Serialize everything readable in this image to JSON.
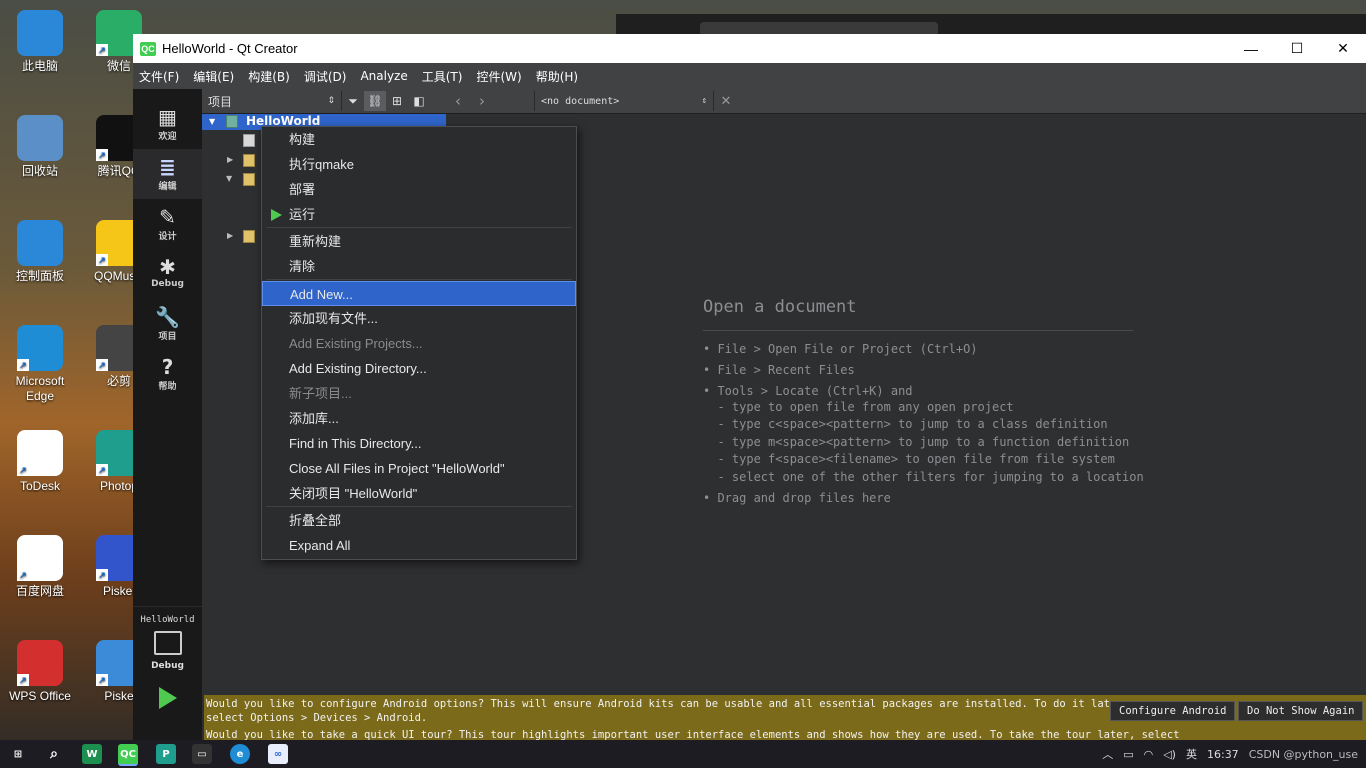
{
  "desktop": {
    "icons": [
      {
        "label": "此电脑",
        "icon": "computer-icon",
        "color": "#2b88d8"
      },
      {
        "label": "微信",
        "icon": "wechat-icon",
        "color": "#2aae67"
      },
      {
        "label": "回收站",
        "icon": "recycle-bin-icon",
        "color": "#5a8fc8"
      },
      {
        "label": "腾讯QQ",
        "icon": "qq-icon",
        "color": "#111111"
      },
      {
        "label": "控制面板",
        "icon": "control-panel-icon",
        "color": "#2b88d8"
      },
      {
        "label": "QQMusic",
        "icon": "qqmusic-icon",
        "color": "#f5c518"
      },
      {
        "label": "Microsoft Edge",
        "icon": "edge-icon",
        "color": "#1f8dd6"
      },
      {
        "label": "必剪",
        "icon": "bijian-icon",
        "color": "#444444"
      },
      {
        "label": "ToDesk",
        "icon": "todesk-icon",
        "color": "#ffffff"
      },
      {
        "label": "Photop",
        "icon": "photopea-icon",
        "color": "#1f9e8e"
      },
      {
        "label": "百度网盘",
        "icon": "baidu-netdisk-icon",
        "color": "#ffffff"
      },
      {
        "label": "Piskel",
        "icon": "piskel-icon",
        "color": "#3355cc"
      },
      {
        "label": "WPS Office",
        "icon": "wps-icon",
        "color": "#d32f2f"
      },
      {
        "label": "Piske",
        "icon": "piske-icon",
        "color": "#3b8bd8"
      }
    ]
  },
  "window": {
    "title": "HelloWorld - Qt Creator",
    "app_icon_text": "QC",
    "controls": {
      "minimize": "—",
      "maximize": "☐",
      "close": "✕"
    }
  },
  "menubar": [
    "文件(F)",
    "编辑(E)",
    "构建(B)",
    "调试(D)",
    "Analyze",
    "工具(T)",
    "控件(W)",
    "帮助(H)"
  ],
  "modes": [
    {
      "label": "欢迎",
      "icon": "grid-icon",
      "glyph": "▦"
    },
    {
      "label": "编辑",
      "icon": "edit-doc-icon",
      "glyph": "≣"
    },
    {
      "label": "设计",
      "icon": "pencil-icon",
      "glyph": "✎"
    },
    {
      "label": "Debug",
      "icon": "bug-icon",
      "glyph": "✱"
    },
    {
      "label": "项目",
      "icon": "wrench-icon",
      "glyph": "🔧"
    },
    {
      "label": "帮助",
      "icon": "help-icon",
      "glyph": "?"
    }
  ],
  "navigator": {
    "combo": "项目",
    "root": "HelloWorld"
  },
  "editor_toolbar": {
    "document": "<no document>"
  },
  "context_menu": {
    "items": [
      {
        "label": "构建",
        "enabled": true
      },
      {
        "label": "执行qmake",
        "enabled": true
      },
      {
        "label": "部署",
        "enabled": true
      },
      {
        "label": "运行",
        "enabled": true
      },
      {
        "label": "重新构建",
        "enabled": true
      },
      {
        "label": "清除",
        "enabled": true
      },
      {
        "label": "Add New...",
        "enabled": true,
        "highlighted": true
      },
      {
        "label": "添加现有文件...",
        "enabled": true
      },
      {
        "label": "Add Existing Projects...",
        "enabled": false
      },
      {
        "label": "Add Existing Directory...",
        "enabled": true
      },
      {
        "label": "新子项目...",
        "enabled": false
      },
      {
        "label": "添加库...",
        "enabled": true
      },
      {
        "label": "Find in This Directory...",
        "enabled": true
      },
      {
        "label": "Close All Files in Project \"HelloWorld\"",
        "enabled": true
      },
      {
        "label": "关闭项目 \"HelloWorld\"",
        "enabled": true
      },
      {
        "label": "折叠全部",
        "enabled": true
      },
      {
        "label": "Expand All",
        "enabled": true
      }
    ]
  },
  "open_document": {
    "title": "Open a document",
    "hints": [
      "• File > Open File or Project (Ctrl+O)",
      "• File > Recent Files",
      "• Tools > Locate (Ctrl+K) and",
      "  - type to open file from any open project",
      "  - type c<space><pattern> to jump to a class definition",
      "  - type m<space><pattern> to jump to a function definition",
      "  - type f<space><filename> to open file from file system",
      "  - select one of the other filters for jumping to a location",
      "• Drag and drop files here"
    ]
  },
  "kit_selector": {
    "project": "HelloWorld",
    "build": "Debug"
  },
  "infobars": {
    "android_line1": "Would you like to configure Android options? This will ensure Android kits can be usable and all essential packages are installed. To do it later,",
    "android_line2": "select Options > Devices > Android.",
    "configure_button": "Configure Android",
    "dont_show_button": "Do Not Show Again",
    "tour_line": "Would you like to take a quick UI tour? This tour highlights important user interface elements and shows how they are used. To take the tour later, select"
  },
  "taskbar": {
    "tray_time": "16:37",
    "watermark": "CSDN @python_use"
  },
  "colors": {
    "accent": "#2f65ca",
    "infobar": "#7a6a1a",
    "run_green": "#4fc94f"
  }
}
